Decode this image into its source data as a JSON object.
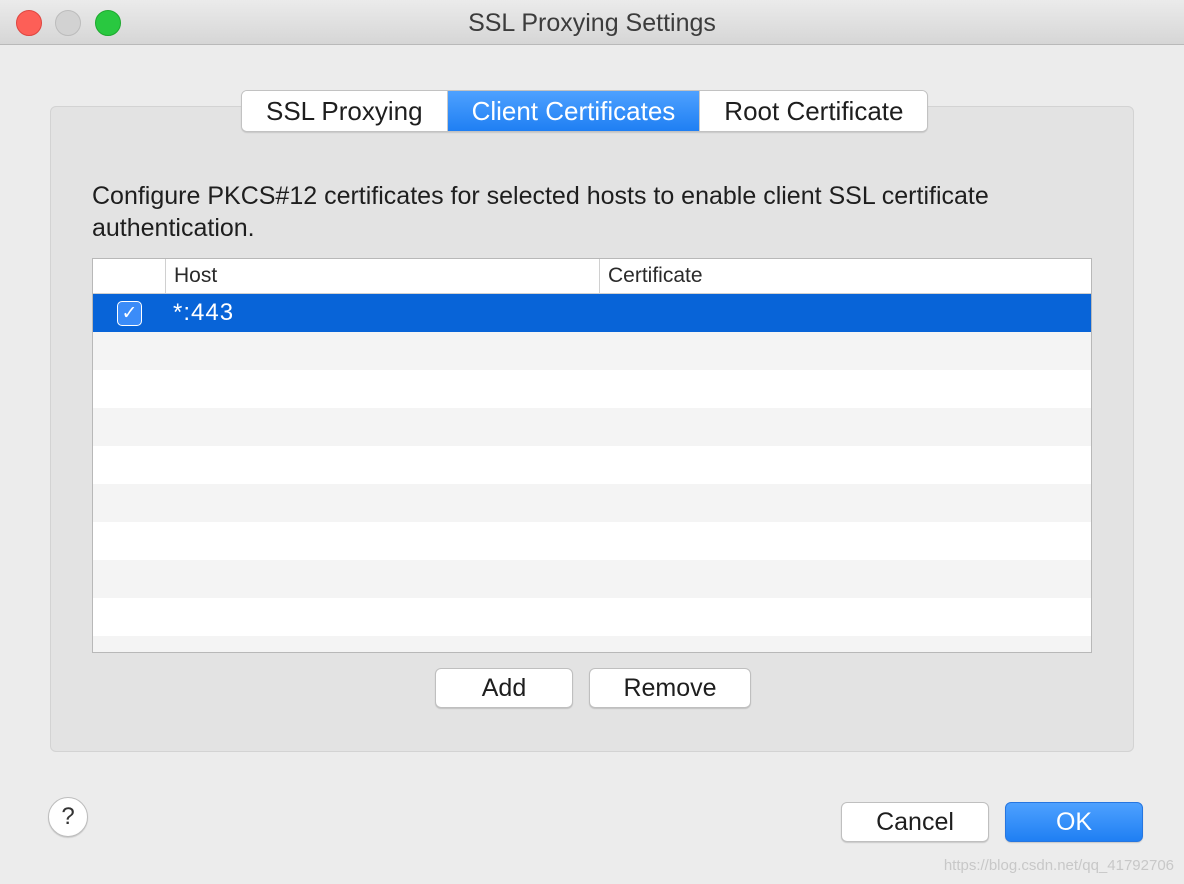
{
  "window": {
    "title": "SSL Proxying Settings"
  },
  "tabs": [
    {
      "label": "SSL Proxying",
      "active": false
    },
    {
      "label": "Client Certificates",
      "active": true
    },
    {
      "label": "Root Certificate",
      "active": false
    }
  ],
  "description": "Configure PKCS#12 certificates for selected hosts to enable client SSL certificate authentication.",
  "table": {
    "columns": [
      "",
      "Host",
      "Certificate"
    ],
    "rows": [
      {
        "enabled": true,
        "host": "*:443",
        "certificate": "",
        "selected": true
      }
    ]
  },
  "buttons": {
    "add": "Add",
    "remove": "Remove",
    "cancel": "Cancel",
    "ok": "OK",
    "help": "?"
  },
  "icons": {
    "checkmark": "✓"
  },
  "colors": {
    "accent": "#1f7ff3",
    "selection": "#0864d8"
  },
  "watermark": "https://blog.csdn.net/qq_41792706"
}
